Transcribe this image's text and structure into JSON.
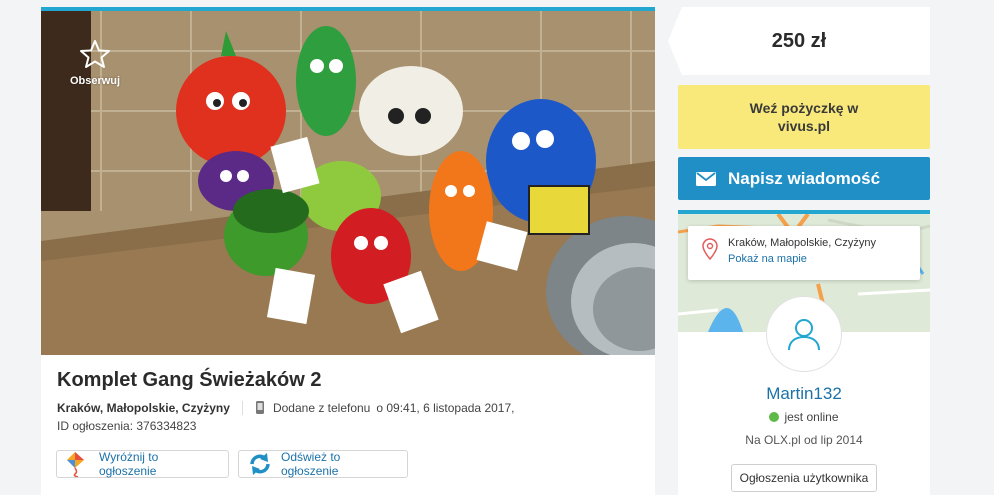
{
  "listing": {
    "observe_label": "Obserwuj",
    "title": "Komplet Gang Świeżaków 2",
    "location": "Kraków, Małopolskie, Czyżyny",
    "added_text": "Dodane z telefonu",
    "added_date": "o 09:41, 6 listopada 2017,",
    "id_text": "ID ogłoszenia: 376334823",
    "promote_label": "Wyróżnij to ogłoszenie",
    "refresh_label": "Odśwież to ogłoszenie"
  },
  "sidebar": {
    "price": "250 zł",
    "loan_label": "Weź pożyczkę w vivus.pl",
    "message_label": "Napisz wiadomość",
    "map_address": "Kraków, Małopolskie, Czyżyny",
    "map_show": "Pokaż na mapie",
    "username": "Martin132",
    "online_status": "jest online",
    "member_since": "Na OLX.pl od lip 2014",
    "user_ads_label": "Ogłoszenia użytkownika"
  },
  "colors": {
    "accent": "#23a6d0",
    "link": "#1b72a8",
    "message_button": "#1f8fc6",
    "loan_bg": "#f8e97a",
    "online": "#5eb947"
  },
  "icons": [
    "star-icon",
    "phone-icon",
    "kite-icon",
    "refresh-icon",
    "envelope-icon",
    "map-pin-icon",
    "user-icon"
  ]
}
